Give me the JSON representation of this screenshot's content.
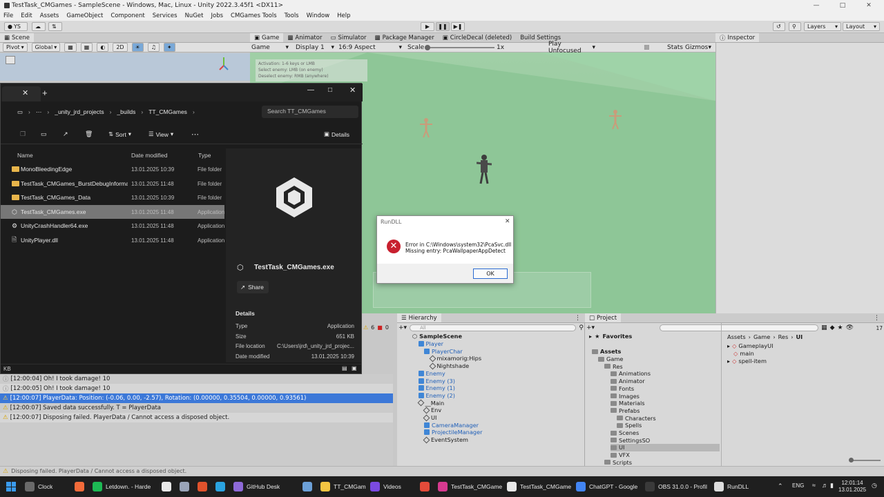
{
  "window": {
    "title": "TestTask_CMGames - SampleScene - Windows, Mac, Linux - Unity 2022.3.45f1 <DX11>"
  },
  "menu": [
    "File",
    "Edit",
    "Assets",
    "GameObject",
    "Component",
    "Services",
    "NuGet",
    "Jobs",
    "CMGames Tools",
    "Tools",
    "Window",
    "Help"
  ],
  "toolbar": {
    "account": "YS",
    "layers": "Layers",
    "layout": "Layout"
  },
  "scene": {
    "tab": "Scene",
    "pivot": "Pivot",
    "global": "Global",
    "mode2d": "2D"
  },
  "game": {
    "tabs": [
      "Game",
      "Animator",
      "Simulator",
      "Package Manager",
      "CircleDecal (deleted)",
      "Build Settings"
    ],
    "view": "Game",
    "display": "Display 1",
    "aspect": "16:9 Aspect",
    "scale_label": "Scale",
    "scale_value": "1x",
    "play_mode": "Play Unfocused",
    "stats": "Stats",
    "gizmos": "Gizmos",
    "hint_lines": [
      "Activation: 1-6 keys or LMB",
      "Select enemy: LMB (on enemy)",
      "Deselect enemy: RMB (anywhere)"
    ]
  },
  "inspector": {
    "tab": "Inspector"
  },
  "explorer": {
    "breadcrumb": [
      "_unity_jrd_projects",
      "_builds",
      "TT_CMGames"
    ],
    "search_placeholder": "Search TT_CMGames",
    "sort": "Sort",
    "view": "View",
    "details_btn": "Details",
    "columns": [
      "Name",
      "Date modified",
      "Type"
    ],
    "rows": [
      {
        "name": "MonoBleedingEdge",
        "date": "13.01.2025 10:39",
        "type": "File folder"
      },
      {
        "name": "TestTask_CMGames_BurstDebugInformat...",
        "date": "13.01.2025 11:48",
        "type": "File folder"
      },
      {
        "name": "TestTask_CMGames_Data",
        "date": "13.01.2025 10:39",
        "type": "File folder"
      },
      {
        "name": "TestTask_CMGames.exe",
        "date": "13.01.2025 11:48",
        "type": "Application"
      },
      {
        "name": "UnityCrashHandler64.exe",
        "date": "13.01.2025 11:48",
        "type": "Application"
      },
      {
        "name": "UnityPlayer.dll",
        "date": "13.01.2025 11:48",
        "type": "Application"
      }
    ],
    "details": {
      "file_name": "TestTask_CMGames.exe",
      "share": "Share",
      "heading": "Details",
      "fields": [
        {
          "label": "Type",
          "value": "Application"
        },
        {
          "label": "Size",
          "value": "651 KB"
        },
        {
          "label": "File location",
          "value": "C:\\Users\\jrd\\_unity_jrd_projec..."
        },
        {
          "label": "Date modified",
          "value": "13.01.2025 10:39"
        }
      ]
    },
    "status": "KB"
  },
  "dialog": {
    "title": "RunDLL",
    "message_line1": "Error in C:\\Windows\\system32\\PcaSvc.dll",
    "message_line2": "Missing entry: PcaWallpaperAppDetect",
    "ok": "OK"
  },
  "console": {
    "lines": [
      {
        "text": "[12:00:04] Oh! I took damage! 10",
        "level": "info"
      },
      {
        "text": "[12:00:05] Oh! I took damage! 10",
        "level": "info"
      },
      {
        "text": "[12:00:07] PlayerData: Position: (-0.06, 0.00, -2.57), Rotation: (0.00000, 0.35504, 0.00000, 0.93561)",
        "level": "warning",
        "selected": true
      },
      {
        "text": "[12:00:07] Saved data successfully. T = PlayerData",
        "level": "warning"
      },
      {
        "text": "[12:00:07] Disposing failed. PlayerData / Cannot access a disposed object.",
        "level": "warning"
      }
    ],
    "count_warn": "6",
    "count_err": "0"
  },
  "hierarchy": {
    "tab": "Hierarchy",
    "search_placeholder": "All",
    "items": [
      {
        "label": "SampleScene",
        "depth": 0,
        "kind": "scene"
      },
      {
        "label": "Player",
        "depth": 1,
        "kind": "prefab"
      },
      {
        "label": "PlayerChar",
        "depth": 2,
        "kind": "prefab"
      },
      {
        "label": "mixamorig:Hips",
        "depth": 3,
        "kind": "object"
      },
      {
        "label": "Nightshade",
        "depth": 3,
        "kind": "object"
      },
      {
        "label": "Enemy",
        "depth": 1,
        "kind": "prefab"
      },
      {
        "label": "Enemy (3)",
        "depth": 1,
        "kind": "prefab"
      },
      {
        "label": "Enemy (1)",
        "depth": 1,
        "kind": "prefab"
      },
      {
        "label": "Enemy (2)",
        "depth": 1,
        "kind": "prefab"
      },
      {
        "label": "__Main",
        "depth": 1,
        "kind": "object"
      },
      {
        "label": "Env",
        "depth": 2,
        "kind": "object"
      },
      {
        "label": "UI",
        "depth": 2,
        "kind": "object"
      },
      {
        "label": "CameraManager",
        "depth": 2,
        "kind": "prefab"
      },
      {
        "label": "ProjectileManager",
        "depth": 2,
        "kind": "prefab"
      },
      {
        "label": "EventSystem",
        "depth": 2,
        "kind": "object"
      }
    ]
  },
  "project": {
    "tab": "Project",
    "count": "17",
    "favorites": "Favorites",
    "tree": [
      {
        "label": "Assets",
        "depth": 0,
        "bold": true
      },
      {
        "label": "Game",
        "depth": 1
      },
      {
        "label": "Res",
        "depth": 2
      },
      {
        "label": "Animations",
        "depth": 3
      },
      {
        "label": "Animator",
        "depth": 3
      },
      {
        "label": "Fonts",
        "depth": 3
      },
      {
        "label": "Images",
        "depth": 3
      },
      {
        "label": "Materials",
        "depth": 3
      },
      {
        "label": "Prefabs",
        "depth": 3
      },
      {
        "label": "Characters",
        "depth": 4
      },
      {
        "label": "Spells",
        "depth": 4
      },
      {
        "label": "Scenes",
        "depth": 3
      },
      {
        "label": "SettingsSO",
        "depth": 3
      },
      {
        "label": "UI",
        "depth": 3,
        "selected": true
      },
      {
        "label": "VFX",
        "depth": 3
      },
      {
        "label": "Scripts",
        "depth": 2
      }
    ],
    "breadcrumb": [
      "Assets",
      "Game",
      "Res",
      "UI"
    ],
    "files": [
      "GameplayUI",
      "main",
      "spell-item"
    ]
  },
  "statusbar": {
    "text": "Disposing failed. PlayerData / Cannot access a disposed object."
  },
  "taskbar": {
    "items": [
      {
        "label": "Clock",
        "color": "#6a6a6a"
      },
      {
        "label": "",
        "color": "#f26b3a"
      },
      {
        "label": "Letdown. - Harde",
        "color": "#1db954"
      },
      {
        "label": "",
        "color": "#e8e8e8"
      },
      {
        "label": "",
        "color": "#9aa4b8"
      },
      {
        "label": "",
        "color": "#e0522c"
      },
      {
        "label": "",
        "color": "#2aa3e0"
      },
      {
        "label": "GitHub Desk",
        "color": "#8e6ad8"
      },
      {
        "label": "",
        "color": "#6ca0d8"
      },
      {
        "label": "TT_CMGam",
        "color": "#f4c542"
      },
      {
        "label": "Videos",
        "color": "#7b4ae2"
      },
      {
        "label": "",
        "color": "#e34b3a"
      },
      {
        "label": "TestTask_CMGame",
        "color": "#d63a8f"
      },
      {
        "label": "TestTask_CMGame",
        "color": "#e8e8e8"
      },
      {
        "label": "ChatGPT - Google",
        "color": "#4285f4"
      },
      {
        "label": "OBS 31.0.0 - Profil",
        "color": "#3a3a3a"
      },
      {
        "label": "RunDLL",
        "color": "#dddddd"
      }
    ],
    "lang": "ENG",
    "time": "12:01:14",
    "date": "13.01.2025"
  }
}
